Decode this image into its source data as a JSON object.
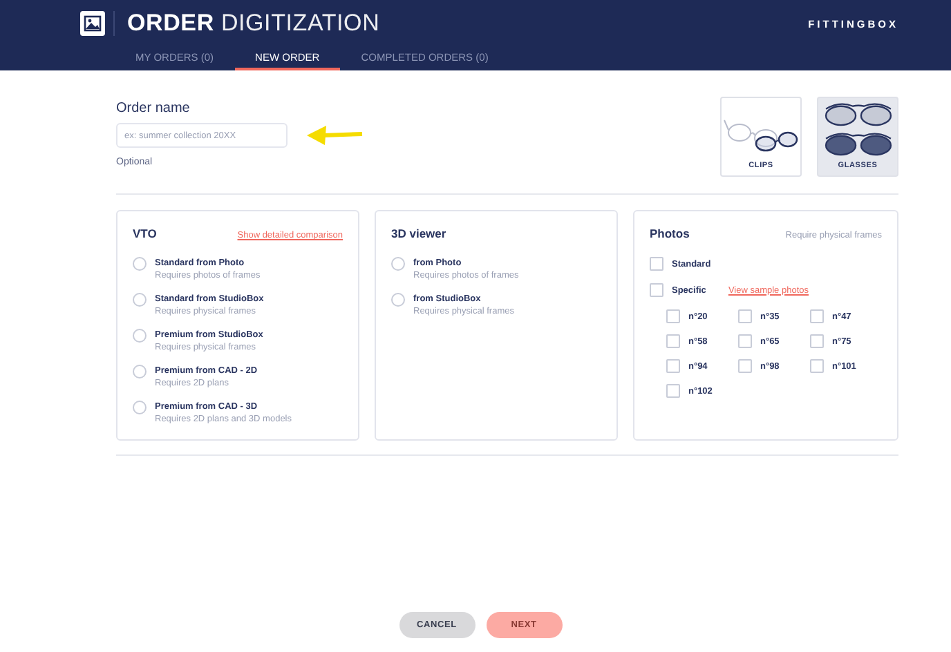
{
  "header": {
    "title_bold": "ORDER",
    "title_light": "DIGITIZATION",
    "brand": "FITTINGBOX"
  },
  "tabs": [
    {
      "label": "MY ORDERS (0)",
      "selected": false
    },
    {
      "label": "NEW ORDER",
      "selected": true
    },
    {
      "label": "COMPLETED ORDERS (0)",
      "selected": false
    }
  ],
  "order_name": {
    "label": "Order name",
    "placeholder": "ex: summer collection 20XX",
    "hint": "Optional"
  },
  "frame_types": [
    {
      "label": "CLIPS",
      "kind": "clips",
      "selected": false
    },
    {
      "label": "GLASSES",
      "kind": "glasses",
      "selected": true
    }
  ],
  "panels": [
    {
      "kind": "radio",
      "title": "VTO",
      "link": "Show detailed comparison",
      "options": [
        {
          "name": "Standard from Photo",
          "note": "Requires photos of frames",
          "selected": false
        },
        {
          "name": "Standard from StudioBox",
          "note": "Requires physical frames",
          "selected": false
        },
        {
          "name": "Premium from StudioBox",
          "note": "Requires physical frames",
          "selected": false
        },
        {
          "name": "Premium from CAD - 2D",
          "note": "Requires 2D plans",
          "selected": false
        },
        {
          "name": "Premium from CAD - 3D",
          "note": "Requires 2D plans and 3D models",
          "selected": false
        }
      ]
    },
    {
      "kind": "radio",
      "title": "3D viewer",
      "options": [
        {
          "name": "from Photo",
          "note": "Requires photos of frames",
          "selected": false
        },
        {
          "name": "from StudioBox",
          "note": "Requires physical frames",
          "selected": false
        }
      ]
    },
    {
      "kind": "checks",
      "title": "Photos",
      "note": "Require physical frames",
      "options": [
        {
          "label": "Standard",
          "checked": false
        },
        {
          "label": "Specific",
          "checked": false,
          "link": "View sample photos"
        }
      ],
      "sizes": [
        {
          "label": "n°20",
          "checked": false
        },
        {
          "label": "n°35",
          "checked": false
        },
        {
          "label": "n°47",
          "checked": false
        },
        {
          "label": "n°58",
          "checked": false
        },
        {
          "label": "n°65",
          "checked": false
        },
        {
          "label": "n°75",
          "checked": false
        },
        {
          "label": "n°94",
          "checked": false
        },
        {
          "label": "n°98",
          "checked": false
        },
        {
          "label": "n°101",
          "checked": false
        },
        {
          "label": "n°102",
          "checked": false
        }
      ]
    }
  ],
  "buttons": [
    {
      "label": "CANCEL",
      "kind": "secondary",
      "disabled": false
    },
    {
      "label": "NEXT",
      "kind": "primary",
      "disabled": true
    }
  ]
}
